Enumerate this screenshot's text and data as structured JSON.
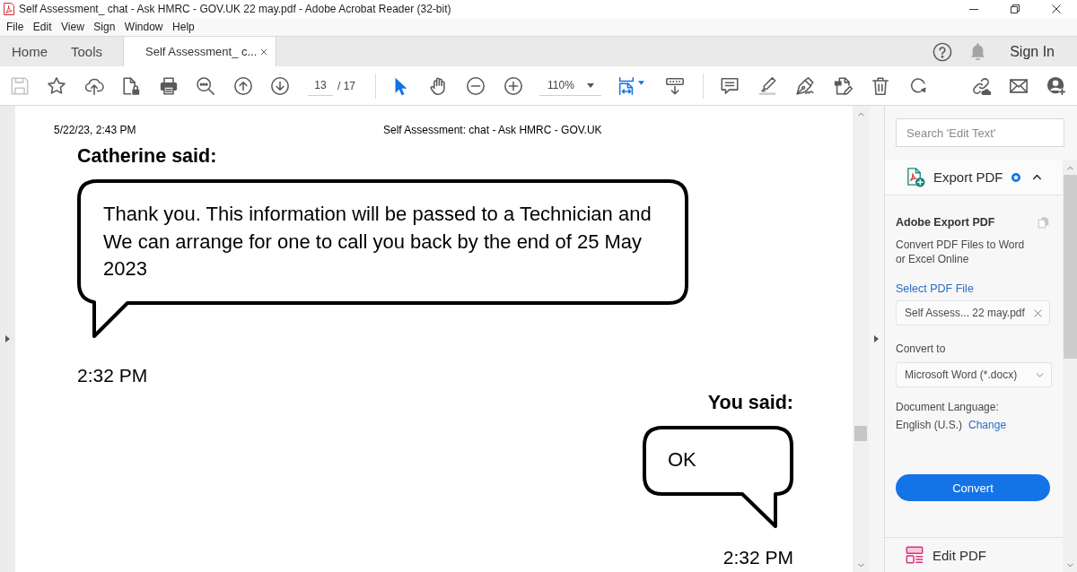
{
  "window": {
    "title": "Self Assessment_ chat - Ask HMRC - GOV.UK 22 may.pdf - Adobe Acrobat Reader (32-bit)"
  },
  "menu": [
    "File",
    "Edit",
    "View",
    "Sign",
    "Window",
    "Help"
  ],
  "tabs": [
    {
      "label": "Home",
      "selected": false,
      "closable": false
    },
    {
      "label": "Tools",
      "selected": false,
      "closable": false
    },
    {
      "label": "Self Assessment_ c...",
      "selected": true,
      "closable": true
    }
  ],
  "account": {
    "sign_in": "Sign In"
  },
  "toolbar": {
    "save": {
      "disabled": true
    },
    "page_number": "13",
    "page_count": "/ 17",
    "select_tool": {
      "selected": true
    },
    "hand_tool": {
      "selected": false
    },
    "zoom": "110%"
  },
  "document": {
    "header_date": "5/22/23, 2:43 PM",
    "header_title": "Self Assessment: chat - Ask HMRC - GOV.UK",
    "messages": [
      {
        "kind": "received",
        "sender": "Catherine said:",
        "text": "Thank you. This information will be passed to a Technician and We can arrange for one to call you back by the end of 25 May 2023",
        "time": "2:32 PM"
      },
      {
        "kind": "sent",
        "sender": "You said:",
        "text": "OK",
        "time": "2:32 PM"
      }
    ]
  },
  "right_panel": {
    "search": {
      "placeholder": "Search 'Edit Text'"
    },
    "tool": {
      "title": "Export PDF",
      "expanded": true
    },
    "export": {
      "heading": "Adobe Export PDF",
      "description": "Convert PDF Files to Word or Excel Online",
      "select_label": "Select PDF File",
      "file_name": "Self Assess... 22 may.pdf",
      "convert_to_label": "Convert to",
      "format": "Microsoft Word (*.docx)",
      "language_label": "Document Language:",
      "language": "English (U.S.)",
      "change_link": "Change",
      "convert_button": "Convert"
    },
    "next_tool": {
      "title": "Edit PDF"
    }
  }
}
